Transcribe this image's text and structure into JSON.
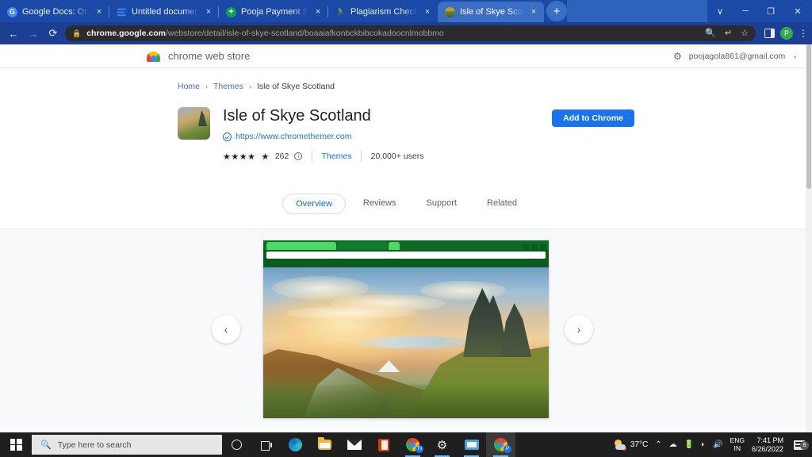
{
  "browser": {
    "tabs": [
      {
        "title": "Google Docs: Online Docum",
        "close": "×",
        "icon": "gdocs-icon",
        "active": false
      },
      {
        "title": "Untitled document - Google",
        "close": "×",
        "icon": "google-docs-file-icon",
        "active": false
      },
      {
        "title": "Pooja Payment Sheet - Goog",
        "close": "×",
        "icon": "google-sheets-icon",
        "active": false
      },
      {
        "title": "Plagiarism Checker - Free &",
        "close": "×",
        "icon": "plagiarism-icon",
        "active": false
      },
      {
        "title": "Isle of Skye Scotland - Chrom",
        "close": "×",
        "icon": "theme-icon",
        "active": true
      }
    ],
    "new_tab_label": "+",
    "window_controls": {
      "tablist": "∨",
      "minimize": "─",
      "maximize": "❐",
      "close": "✕"
    },
    "nav": {
      "back": "←",
      "forward": "→",
      "reload": "⟳"
    },
    "omnibox": {
      "lock": "🔒",
      "url_host": "chrome.google.com",
      "url_path": "/webstore/detail/isle-of-skye-scotland/boaaiafkonbckbibcokadoocnlmobbmo",
      "actions": {
        "search": "🔍",
        "share": "↱",
        "bookmark": "☆"
      }
    },
    "toolbar_right": {
      "avatar_letter": "P",
      "menu": "⋮"
    }
  },
  "store_header": {
    "brand": "chrome web store",
    "gear": "⚙",
    "account_email": "poojagola861@gmail.com",
    "chevron": "⌄"
  },
  "breadcrumb": {
    "home": "Home",
    "sep": "›",
    "category": "Themes",
    "current": "Isle of Skye Scotland"
  },
  "item": {
    "name": "Isle of Skye Scotland",
    "site_url": "https://www.chromethemer.com",
    "stars": "★★★★",
    "half_star": "☆",
    "rating_count": "262",
    "info": "i",
    "category_link": "Themes",
    "users": "20,000+ users",
    "add_button": "Add to Chrome"
  },
  "page_tabs": [
    {
      "label": "Overview",
      "active": true
    },
    {
      "label": "Reviews",
      "active": false
    },
    {
      "label": "Support",
      "active": false
    },
    {
      "label": "Related",
      "active": false
    }
  ],
  "gallery": {
    "prev": "‹",
    "next": "›",
    "screenshot_alt": "Isle of Skye Scotland theme preview"
  },
  "taskbar": {
    "search_placeholder": "Type here to search",
    "search_icon": "⚲",
    "apps": [
      {
        "name": "cortana",
        "label": ""
      },
      {
        "name": "task-view",
        "label": ""
      },
      {
        "name": "microsoft-edge",
        "label": ""
      },
      {
        "name": "file-explorer",
        "label": ""
      },
      {
        "name": "mail",
        "label": ""
      },
      {
        "name": "office",
        "label": ""
      },
      {
        "name": "chrome-tv",
        "label": "Tv"
      },
      {
        "name": "settings",
        "label": "⚙"
      },
      {
        "name": "photos",
        "label": ""
      },
      {
        "name": "chrome",
        "label": "P"
      }
    ],
    "tray": {
      "temperature": "37°C",
      "chevron_up": "⌃",
      "onedrive": "☁",
      "battery": "🔋",
      "wifi": "◠",
      "volume": "🔊",
      "lang_line1": "ENG",
      "lang_line2": "IN",
      "time": "7:41 PM",
      "date": "6/26/2022",
      "notification_count": "8"
    }
  }
}
